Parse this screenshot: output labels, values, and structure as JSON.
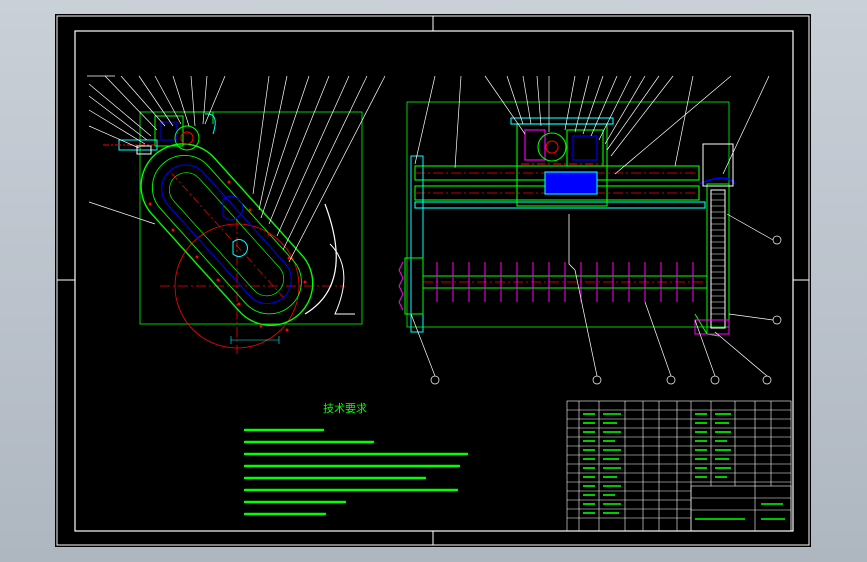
{
  "drawing": {
    "tech_title": "技术要求",
    "colors": {
      "background": "#000000",
      "frame": "#ffffff",
      "outline": "#00ff00",
      "hidden": "#ff0000",
      "center_line": "#ff0000",
      "chain": "#0000ff",
      "dimension": "#00ffff",
      "accent": "#ff00ff"
    }
  }
}
